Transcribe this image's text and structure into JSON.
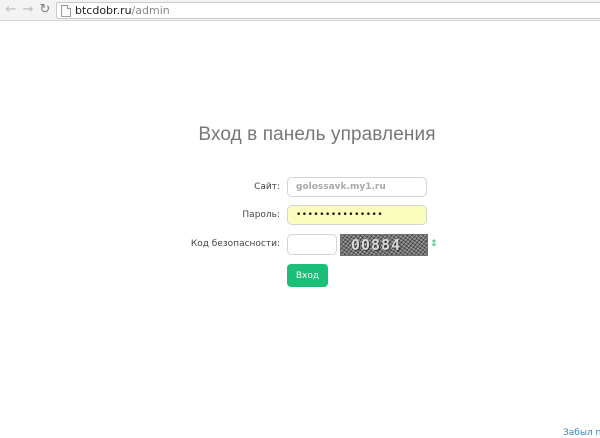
{
  "browser": {
    "back_icon": "←",
    "forward_icon": "→",
    "reload_icon": "↻",
    "url_host": "btcdobr.ru",
    "url_path": "/admin"
  },
  "login": {
    "title": "Вход в панель управления",
    "site_label": "Сайт:",
    "site_value": "golossavk.my1.ru",
    "password_label": "Пароль:",
    "password_value": "•••••••••••••••",
    "captcha_label": "Код безопасности:",
    "captcha_value": "",
    "captcha_text": "00884",
    "refresh_icon": "⇕",
    "submit_label": "Вход",
    "forgot_link": "Забыл п"
  },
  "colors": {
    "accent": "#1bbf78",
    "password_fill": "#fbfdbc",
    "link": "#2a86c9"
  }
}
